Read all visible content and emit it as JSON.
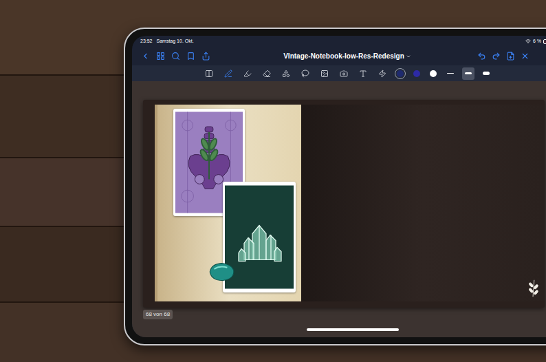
{
  "status_bar": {
    "time": "23:52",
    "date": "Samstag 10. Okt.",
    "battery": "6 %",
    "battery_level": 0.06
  },
  "nav": {
    "title": "VIntage-Notebook-low-Res-Redesign"
  },
  "toolbar": {
    "tools": [
      {
        "kind": "reading",
        "selected": false
      },
      {
        "kind": "pen",
        "selected": true
      },
      {
        "kind": "highlighter",
        "selected": false
      },
      {
        "kind": "eraser",
        "selected": false
      },
      {
        "kind": "shapes",
        "selected": false
      },
      {
        "kind": "lasso",
        "selected": false
      },
      {
        "kind": "image",
        "selected": false
      },
      {
        "kind": "camera",
        "selected": false
      },
      {
        "kind": "text",
        "selected": false
      },
      {
        "kind": "laser",
        "selected": false
      }
    ],
    "colors": [
      {
        "color": "#1e2a6e",
        "selected": true
      },
      {
        "color": "#2d2aa6",
        "selected": false
      },
      {
        "color": "#ffffff",
        "selected": false
      }
    ],
    "widths": [
      {
        "kind": "thin",
        "selected": false
      },
      {
        "kind": "medium",
        "selected": true
      },
      {
        "kind": "thick",
        "selected": false
      }
    ]
  },
  "notebook": {
    "cards": [
      {
        "kind": "pelvis",
        "color": "#9a7fc0"
      },
      {
        "kind": "crystal",
        "color": "#173e36"
      }
    ]
  },
  "page_indicator": "68 von 68"
}
